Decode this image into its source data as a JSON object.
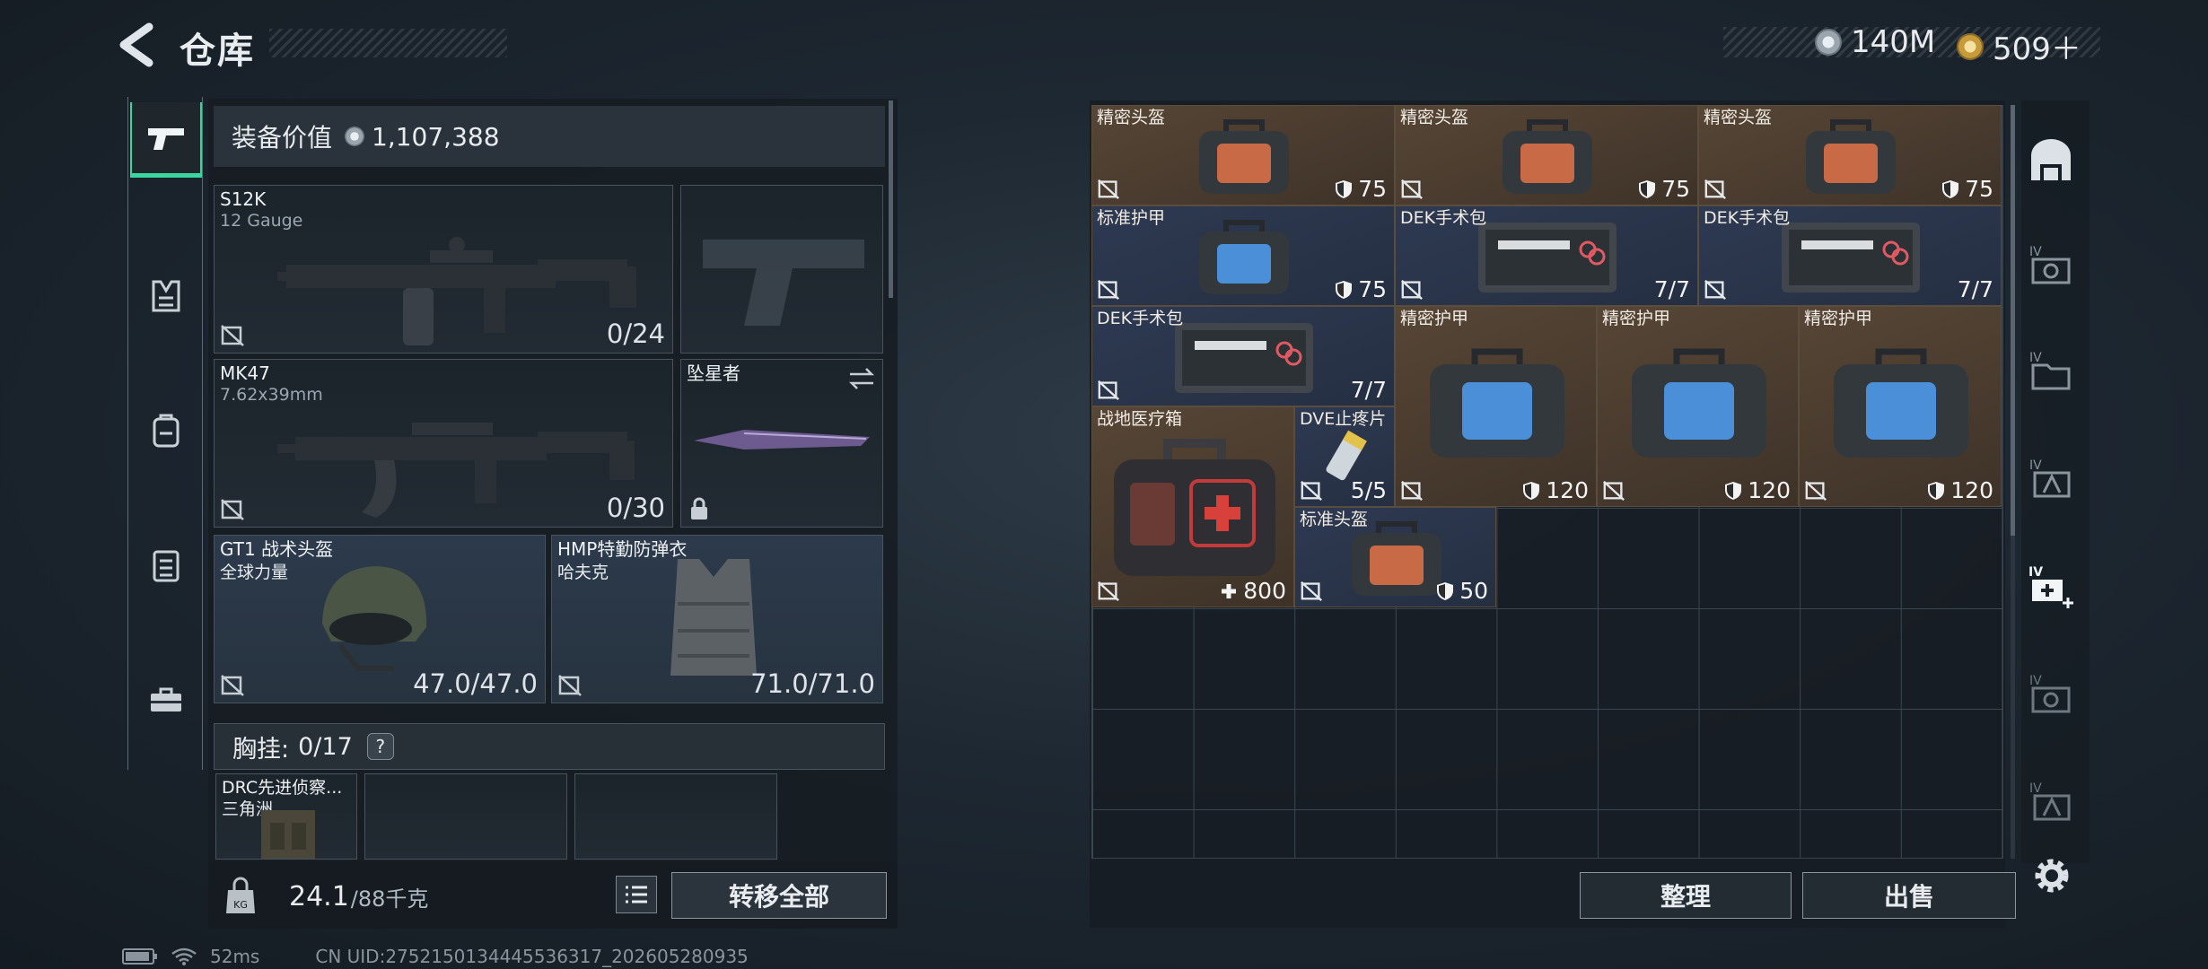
{
  "header": {
    "title": "仓库",
    "currency1": "140M",
    "currency2": "509＋"
  },
  "loadout": {
    "value_label": "装备价值",
    "value": "1,107,388",
    "primary": {
      "name": "S12K",
      "sub": "12 Gauge",
      "count": "0/24"
    },
    "secondary": {
      "name": "MK47",
      "sub": "7.62x39mm",
      "count": "0/30"
    },
    "melee": {
      "name": "坠星者"
    },
    "helmet": {
      "name": "GT1 战术头盔",
      "sub": "全球力量",
      "durability": "47.0/47.0"
    },
    "armor": {
      "name": "HMP特勤防弹衣",
      "sub": "哈夫克",
      "durability": "71.0/71.0"
    },
    "chest_label": "胸挂:",
    "chest_count": "0/17",
    "chest_help": "?",
    "rig": {
      "name": "DRC先进侦察...",
      "sub": "三角洲"
    },
    "weight": "24.1",
    "weight_cap": "/88千克",
    "transfer_all": "转移全部"
  },
  "stash": {
    "items": [
      {
        "name": "精密头盔",
        "value": "75",
        "icon": "shield"
      },
      {
        "name": "精密头盔",
        "value": "75",
        "icon": "shield"
      },
      {
        "name": "精密头盔",
        "value": "75",
        "icon": "shield"
      },
      {
        "name": "标准护甲",
        "value": "75",
        "icon": "shield"
      },
      {
        "name": "DEK手术包",
        "value": "7/7",
        "icon": ""
      },
      {
        "name": "DEK手术包",
        "value": "7/7",
        "icon": ""
      },
      {
        "name": "DEK手术包",
        "value": "7/7",
        "icon": ""
      },
      {
        "name": "精密护甲",
        "value": "120",
        "icon": "shield"
      },
      {
        "name": "精密护甲",
        "value": "120",
        "icon": "shield"
      },
      {
        "name": "精密护甲",
        "value": "120",
        "icon": "shield"
      },
      {
        "name": "战地医疗箱",
        "value": "800",
        "icon": "plus"
      },
      {
        "name": "DVE止疼片",
        "value": "5/5",
        "icon": ""
      },
      {
        "name": "标准头盔",
        "value": "50",
        "icon": "shield"
      }
    ],
    "sort": "整理",
    "sell": "出售"
  },
  "status": {
    "ping": "52ms",
    "uid": "CN UID:2752150134445536317_202605280935"
  },
  "colors": {
    "accent": "#3bd6a0",
    "gold_item": "#574636",
    "navy_item": "#2e3a52"
  }
}
